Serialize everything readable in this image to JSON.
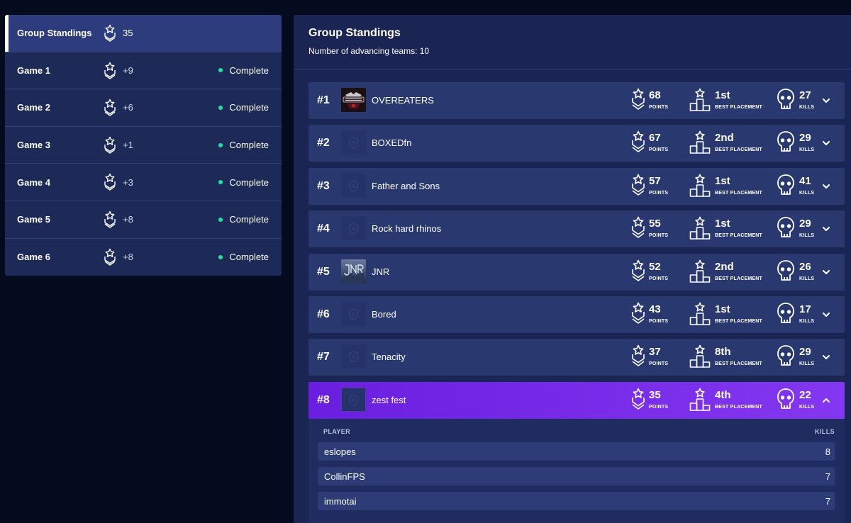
{
  "sidebar": {
    "items": [
      {
        "label": "Group Standings",
        "points": "35",
        "status": "",
        "active": true
      },
      {
        "label": "Game 1",
        "points": "+9",
        "status": "Complete",
        "active": false
      },
      {
        "label": "Game 2",
        "points": "+6",
        "status": "Complete",
        "active": false
      },
      {
        "label": "Game 3",
        "points": "+1",
        "status": "Complete",
        "active": false
      },
      {
        "label": "Game 4",
        "points": "+3",
        "status": "Complete",
        "active": false
      },
      {
        "label": "Game 5",
        "points": "+8",
        "status": "Complete",
        "active": false
      },
      {
        "label": "Game 6",
        "points": "+8",
        "status": "Complete",
        "active": false
      }
    ]
  },
  "main": {
    "title": "Group Standings",
    "subtitle": "Number of advancing teams: 10",
    "captions": {
      "points": "POINTS",
      "placement": "BEST PLACEMENT",
      "kills": "KILLS"
    },
    "teams": [
      {
        "rank": "#1",
        "name": "OVEREATERS",
        "logo": "overeaters-logo",
        "points": "68",
        "placement": "1st",
        "kills": "27",
        "expanded": false
      },
      {
        "rank": "#2",
        "name": "BOXEDfn",
        "logo": "default-shield-logo",
        "points": "67",
        "placement": "2nd",
        "kills": "29",
        "expanded": false
      },
      {
        "rank": "#3",
        "name": "Father and Sons",
        "logo": "default-shield-logo",
        "points": "57",
        "placement": "1st",
        "kills": "41",
        "expanded": false
      },
      {
        "rank": "#4",
        "name": "Rock hard rhinos",
        "logo": "default-shield-logo",
        "points": "55",
        "placement": "1st",
        "kills": "29",
        "expanded": false
      },
      {
        "rank": "#5",
        "name": "JNR",
        "logo": "jnr-logo",
        "points": "52",
        "placement": "2nd",
        "kills": "26",
        "expanded": false
      },
      {
        "rank": "#6",
        "name": "Bored",
        "logo": "default-shield-logo",
        "points": "43",
        "placement": "1st",
        "kills": "17",
        "expanded": false
      },
      {
        "rank": "#7",
        "name": "Tenacity",
        "logo": "default-shield-logo",
        "points": "37",
        "placement": "8th",
        "kills": "29",
        "expanded": false
      },
      {
        "rank": "#8",
        "name": "zest fest",
        "logo": "default-shield-logo",
        "points": "35",
        "placement": "4th",
        "kills": "22",
        "expanded": true
      }
    ],
    "player_table": {
      "headers": {
        "player": "PLAYER",
        "kills": "KILLS"
      },
      "rows": [
        {
          "player": "eslopes",
          "kills": "8"
        },
        {
          "player": "CollinFPS",
          "kills": "7"
        },
        {
          "player": "immotai",
          "kills": "7"
        }
      ]
    }
  },
  "colors": {
    "background": "#050b1e",
    "panel": "#1b2554",
    "row": "#2a3870",
    "accent_purple": "#7a2ff0",
    "status_complete": "#1fe5a4"
  },
  "icons": {
    "points": "chevron-badge-icon",
    "placement": "podium-icon",
    "kills": "skull-icon",
    "expand": "chevron-down-icon",
    "collapse": "chevron-up-icon"
  }
}
